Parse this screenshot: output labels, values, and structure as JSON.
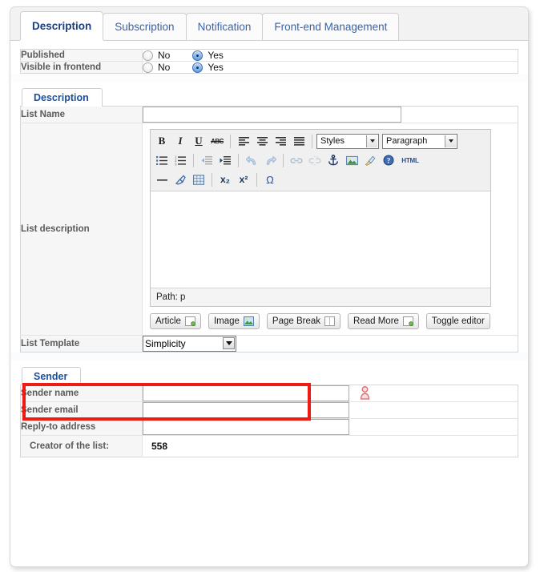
{
  "tabs": [
    {
      "label": "Description",
      "active": true
    },
    {
      "label": "Subscription",
      "active": false
    },
    {
      "label": "Notification",
      "active": false
    },
    {
      "label": "Front-end Management",
      "active": false
    }
  ],
  "toggles": {
    "rows": [
      {
        "label": "Published",
        "no": "No",
        "yes": "Yes",
        "selected": "Yes"
      },
      {
        "label": "Visible in frontend",
        "no": "No",
        "yes": "Yes",
        "selected": "Yes"
      }
    ]
  },
  "description_section": {
    "legend": "Description",
    "list_name": {
      "label": "List Name",
      "value": "",
      "placeholder": ""
    },
    "list_description": {
      "label": "List description"
    },
    "list_template": {
      "label": "List Template",
      "value": "Simplicity",
      "options": [
        "Simplicity"
      ]
    }
  },
  "editor": {
    "styles_select": {
      "label": "Styles"
    },
    "format_select": {
      "label": "Paragraph"
    },
    "path": "Path: p",
    "content": "",
    "toolbar_row1": [
      {
        "name": "bold-icon",
        "glyph": "B"
      },
      {
        "name": "italic-icon",
        "glyph": "I"
      },
      {
        "name": "underline-icon",
        "glyph": "U"
      },
      {
        "name": "strikethrough-icon",
        "glyph": "ABC"
      },
      {
        "name": "align-left-icon",
        "glyph": ""
      },
      {
        "name": "align-center-icon",
        "glyph": ""
      },
      {
        "name": "align-right-icon",
        "glyph": ""
      },
      {
        "name": "align-justify-icon",
        "glyph": ""
      }
    ],
    "toolbar_row2": [
      {
        "name": "bullet-list-icon"
      },
      {
        "name": "numbered-list-icon"
      },
      {
        "name": "outdent-icon"
      },
      {
        "name": "indent-icon"
      },
      {
        "name": "undo-icon"
      },
      {
        "name": "redo-icon"
      },
      {
        "name": "link-icon"
      },
      {
        "name": "unlink-icon"
      },
      {
        "name": "anchor-icon"
      },
      {
        "name": "insert-image-icon"
      },
      {
        "name": "cleanup-icon"
      },
      {
        "name": "help-icon"
      },
      {
        "name": "html-source-icon",
        "glyph": "HTML"
      }
    ],
    "toolbar_row3": [
      {
        "name": "horizontal-rule-icon"
      },
      {
        "name": "remove-format-icon"
      },
      {
        "name": "toggle-guidelines-icon"
      },
      {
        "name": "subscript-icon",
        "glyph": "x₂"
      },
      {
        "name": "superscript-icon",
        "glyph": "x²"
      },
      {
        "name": "special-character-icon",
        "glyph": "Ω"
      }
    ],
    "bottom_buttons": [
      {
        "label": "Article",
        "icon": "article-icon"
      },
      {
        "label": "Image",
        "icon": "image-icon"
      },
      {
        "label": "Page Break",
        "icon": "page-break-icon"
      },
      {
        "label": "Read More",
        "icon": "read-more-icon"
      },
      {
        "label": "Toggle editor",
        "icon": ""
      }
    ]
  },
  "sender_section": {
    "legend": "Sender",
    "rows": [
      {
        "label": "Sender name",
        "value": "",
        "type": "input",
        "icon": "user-select-icon"
      },
      {
        "label": "Sender email",
        "value": "",
        "type": "input",
        "icon": ""
      },
      {
        "label": "Reply-to address",
        "value": "",
        "type": "input",
        "icon": ""
      },
      {
        "label": "Creator of the list:",
        "value": "558",
        "type": "text",
        "icon": ""
      }
    ]
  },
  "colors": {
    "tab_active_text": "#1b3f7e",
    "tab_text": "#3a63a8",
    "legend_text": "#1b4f9c",
    "highlight_border": "#ee1b12",
    "label_text": "#5a5a5a",
    "radio_selected": "#4a87d6"
  }
}
